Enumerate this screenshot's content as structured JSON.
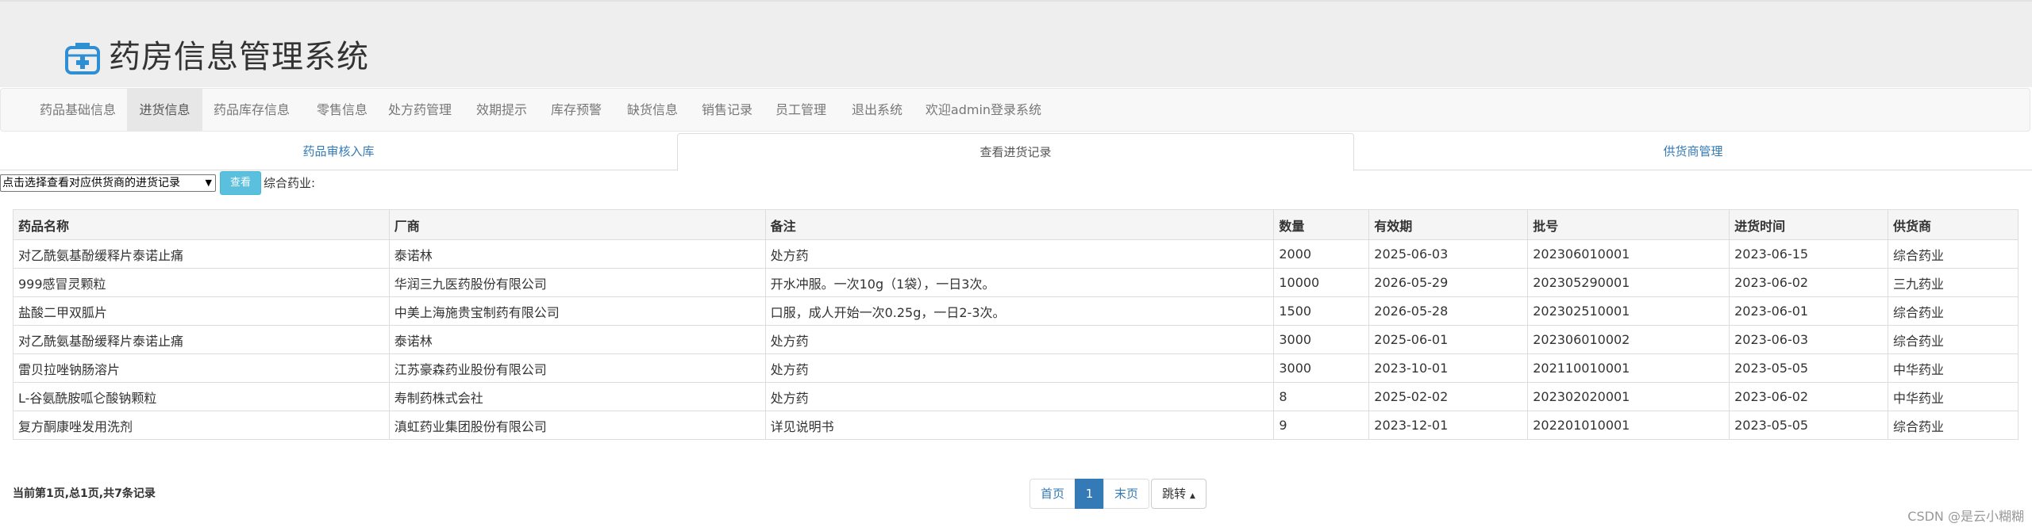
{
  "app": {
    "title": "药房信息管理系统"
  },
  "nav": {
    "items": [
      "药品基础信息",
      "进货信息",
      "药品库存信息",
      "零售信息",
      "处方药管理",
      "效期提示",
      "库存预警",
      "缺货信息",
      "销售记录",
      "员工管理",
      "退出系统",
      "欢迎admin登录系统"
    ],
    "active": "进货信息"
  },
  "tabs": [
    "药品审核入库",
    "查看进货记录",
    "供货商管理"
  ],
  "active_tab": "查看进货记录",
  "filter": {
    "select_value": "点击选择查看对应供货商的进货记录",
    "search_label": "查看",
    "current_supplier": "综合药业:"
  },
  "table": {
    "headers": [
      "药品名称",
      "厂商",
      "备注",
      "数量",
      "有效期",
      "批号",
      "进货时间",
      "供货商"
    ],
    "rows": [
      [
        "对乙酰氨基酚缓释片泰诺止痛",
        "泰诺林",
        "处方药",
        "2000",
        "2025-06-03",
        "202306010001",
        "2023-06-15",
        "综合药业"
      ],
      [
        "999感冒灵颗粒",
        "华润三九医药股份有限公司",
        "开水冲服。一次10g（1袋），一日3次。",
        "10000",
        "2026-05-29",
        "202305290001",
        "2023-06-02",
        "三九药业"
      ],
      [
        "盐酸二甲双胍片",
        "中美上海施贵宝制药有限公司",
        "口服，成人开始一次0.25g，一日2-3次。",
        "1500",
        "2026-05-28",
        "202302510001",
        "2023-06-01",
        "综合药业"
      ],
      [
        "对乙酰氨基酚缓释片泰诺止痛",
        "泰诺林",
        "处方药",
        "3000",
        "2025-06-01",
        "202306010002",
        "2023-06-03",
        "综合药业"
      ],
      [
        "雷贝拉唑钠肠溶片",
        "江苏豪森药业股份有限公司",
        "处方药",
        "3000",
        "2023-10-01",
        "202110010001",
        "2023-05-05",
        "中华药业"
      ],
      [
        "L-谷氨酰胺呱仑酸钠颗粒",
        "寿制药株式会社",
        "处方药",
        "8",
        "2025-02-02",
        "202302020001",
        "2023-06-02",
        "中华药业"
      ],
      [
        "复方酮康唑发用洗剂",
        "滇虹药业集团股份有限公司",
        "详见说明书",
        "9",
        "2023-12-01",
        "202201010001",
        "2023-05-05",
        "综合药业"
      ]
    ]
  },
  "pagination": {
    "status": "当前第1页,总1页,共7条记录",
    "first": "首页",
    "current": "1",
    "last": "末页",
    "jump": "跳转"
  },
  "watermark": "CSDN @是云小糊糊",
  "colors": {
    "accent": "#337ab7",
    "info_button": "#5bc0de"
  }
}
